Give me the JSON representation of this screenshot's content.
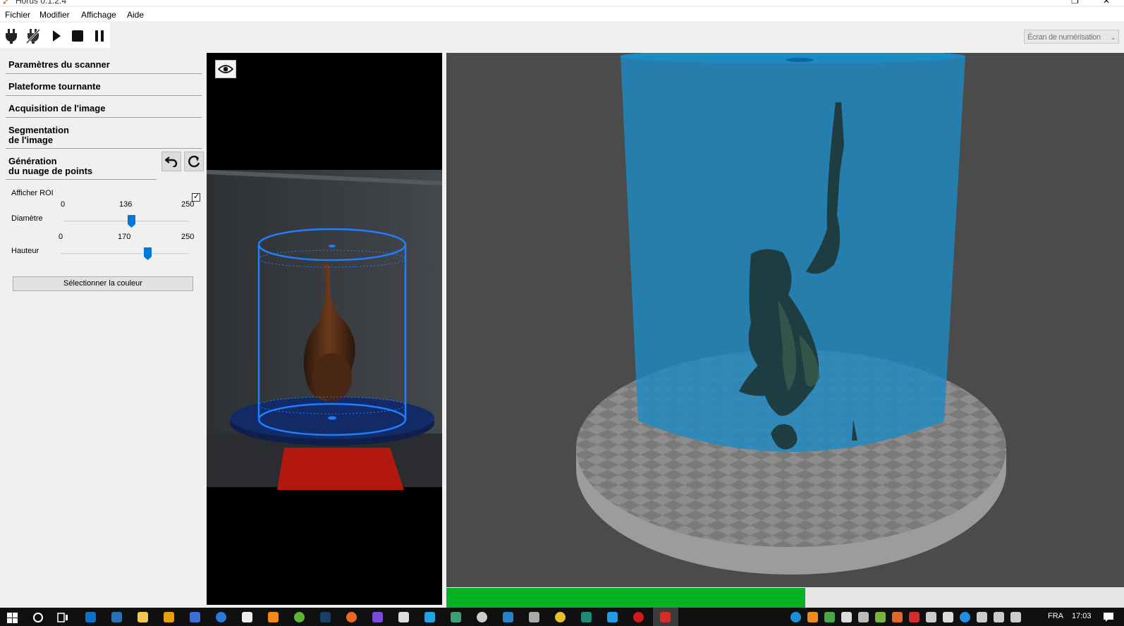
{
  "window": {
    "title": "Horus 0.1.2.4",
    "restore_glyph": "❐",
    "close_glyph": "✕"
  },
  "menu": {
    "items": [
      "Fichier",
      "Modifier",
      "Affichage",
      "Aide"
    ]
  },
  "toolbar": {
    "buttons": [
      "connect-icon",
      "disconnect-icon",
      "play-icon",
      "stop-icon",
      "pause-icon"
    ]
  },
  "view_select": {
    "value": "Écran de numérisation",
    "arrow": "⌄"
  },
  "panel": {
    "sections": [
      "Paramètres du scanner",
      "Plateforme tournante",
      "Acquisition de l'image"
    ],
    "segmentation": [
      "Segmentation",
      "de l'image"
    ],
    "generation": [
      "Génération",
      "du nuage de points"
    ],
    "show_roi": {
      "label": "Afficher ROI",
      "checked": true,
      "mark": "✓"
    },
    "diameter": {
      "label": "Diamètre",
      "min": "0",
      "max": "250",
      "value": "136",
      "value_num": 136
    },
    "height": {
      "label": "Hauteur",
      "min": "0",
      "max": "250",
      "value": "170",
      "value_num": 170
    },
    "color_button": "Sélectionner la couleur"
  },
  "progress": {
    "fraction": 0.53
  },
  "taskbar": {
    "language": "FRA",
    "time": "17:03",
    "colors": {
      "accent": "#0078d7",
      "progress": "#06b025",
      "roi": "#1f7fff"
    }
  }
}
